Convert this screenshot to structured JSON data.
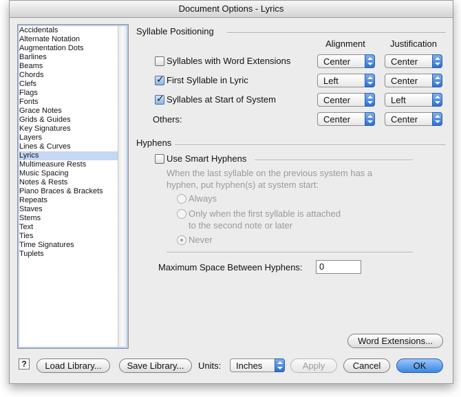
{
  "window": {
    "title": "Document Options - Lyrics"
  },
  "sidebar": {
    "items": [
      {
        "label": "Accidentals"
      },
      {
        "label": "Alternate Notation"
      },
      {
        "label": "Augmentation Dots"
      },
      {
        "label": "Barlines"
      },
      {
        "label": "Beams"
      },
      {
        "label": "Chords"
      },
      {
        "label": "Clefs"
      },
      {
        "label": "Flags"
      },
      {
        "label": "Fonts"
      },
      {
        "label": "Grace Notes"
      },
      {
        "label": "Grids & Guides"
      },
      {
        "label": "Key Signatures"
      },
      {
        "label": "Layers"
      },
      {
        "label": "Lines & Curves"
      },
      {
        "label": "Lyrics",
        "selected": true
      },
      {
        "label": "Multimeasure Rests"
      },
      {
        "label": "Music Spacing"
      },
      {
        "label": "Notes & Rests"
      },
      {
        "label": "Piano Braces & Brackets"
      },
      {
        "label": "Repeats"
      },
      {
        "label": "Staves"
      },
      {
        "label": "Stems"
      },
      {
        "label": "Text"
      },
      {
        "label": "Ties"
      },
      {
        "label": "Time Signatures"
      },
      {
        "label": "Tuplets"
      }
    ]
  },
  "syllable": {
    "section_title": "Syllable Positioning",
    "alignment_header": "Alignment",
    "justification_header": "Justification",
    "rows": [
      {
        "label": "Syllables with Word Extensions",
        "checked": false,
        "alignment": "Center",
        "justification": "Center"
      },
      {
        "label": "First Syllable in Lyric",
        "checked": true,
        "alignment": "Left",
        "justification": "Center"
      },
      {
        "label": "Syllables at Start of System",
        "checked": true,
        "alignment": "Center",
        "justification": "Left"
      },
      {
        "label": "Others:",
        "alignment": "Center",
        "justification": "Center"
      }
    ]
  },
  "hyphens": {
    "section_title": "Hyphens",
    "smart_label": "Use Smart Hyphens",
    "smart_checked": false,
    "description_line1": "When the last syllable on the previous system has a",
    "description_line2": "hyphen, put hyphen(s) at system start:",
    "options": [
      {
        "label": "Always",
        "selected": false
      },
      {
        "label": "Only when the first syllable is attached",
        "label2": "to the second note or later",
        "selected": false
      },
      {
        "label": "Never",
        "selected": true
      }
    ],
    "max_space_label": "Maximum Space Between Hyphens:",
    "max_space_value": "0"
  },
  "buttons": {
    "word_extensions": "Word Extensions...",
    "help": "?",
    "load_library": "Load Library...",
    "save_library": "Save Library...",
    "units_label": "Units:",
    "units_value": "Inches",
    "apply": "Apply",
    "cancel": "Cancel",
    "ok": "OK"
  }
}
